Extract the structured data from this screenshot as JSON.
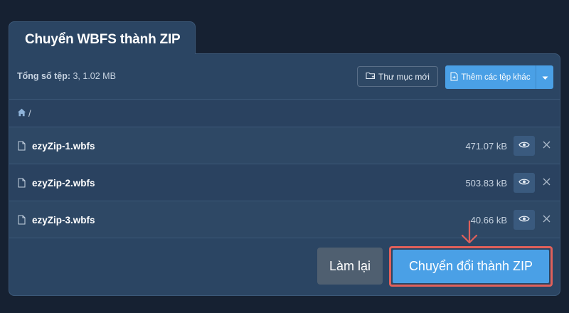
{
  "tab": {
    "title": "Chuyển WBFS thành ZIP"
  },
  "toolbar": {
    "total_label": "Tổng số tệp:",
    "total_value": " 3, 1.02 MB",
    "new_folder_label": "Thư mục mới",
    "add_files_label": "Thêm các tệp khác"
  },
  "breadcrumb": {
    "separator": "/"
  },
  "files": [
    {
      "name": "ezyZip-1.wbfs",
      "size": "471.07 kB"
    },
    {
      "name": "ezyZip-2.wbfs",
      "size": "503.83 kB"
    },
    {
      "name": "ezyZip-3.wbfs",
      "size": "40.66 kB"
    }
  ],
  "actions": {
    "reset_label": "Làm lại",
    "convert_label": "Chuyển đổi thành ZIP"
  },
  "colors": {
    "background": "#162132",
    "panel": "#2b4563",
    "accent": "#4aa0e6",
    "highlight": "#e0605a"
  }
}
